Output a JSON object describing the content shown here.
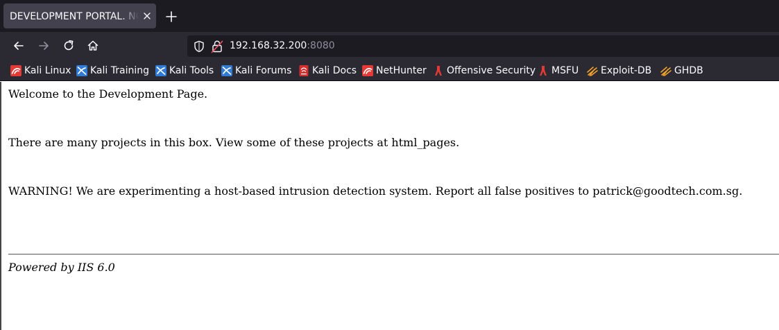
{
  "browser": {
    "tab": {
      "title": "DEVELOPMENT PORTAL. NOT FOR OUTSIDERS OR HACKERS!"
    },
    "address_bar": {
      "host": "192.168.32.200",
      "port": ":8080"
    },
    "bookmarks": [
      {
        "label": "Kali Linux",
        "icon": "kali-linux-icon"
      },
      {
        "label": "Kali Training",
        "icon": "kali-training-icon"
      },
      {
        "label": "Kali Tools",
        "icon": "kali-tools-icon"
      },
      {
        "label": "Kali Forums",
        "icon": "kali-forums-icon"
      },
      {
        "label": "Kali Docs",
        "icon": "kali-docs-icon"
      },
      {
        "label": "NetHunter",
        "icon": "nethunter-icon"
      },
      {
        "label": "Offensive Security",
        "icon": "offensive-security-icon"
      },
      {
        "label": "MSFU",
        "icon": "msfu-icon"
      },
      {
        "label": "Exploit-DB",
        "icon": "exploit-db-icon"
      },
      {
        "label": "GHDB",
        "icon": "ghdb-icon"
      }
    ]
  },
  "page": {
    "welcome": "Welcome to the Development Page.",
    "projects": "There are many projects in this box. View some of these projects at html_pages.",
    "warning": "WARNING! We are experimenting a host-based intrusion detection system. Report all false positives to patrick@goodtech.com.sg.",
    "footer": "Powered by IIS 6.0"
  },
  "colors": {
    "tabstrip": "#1c1b22",
    "toolbar": "#2b2a33",
    "kali_red": "#e53935",
    "kali_blue": "#2f7bd6",
    "exploit_orange": "#f2a12b"
  }
}
